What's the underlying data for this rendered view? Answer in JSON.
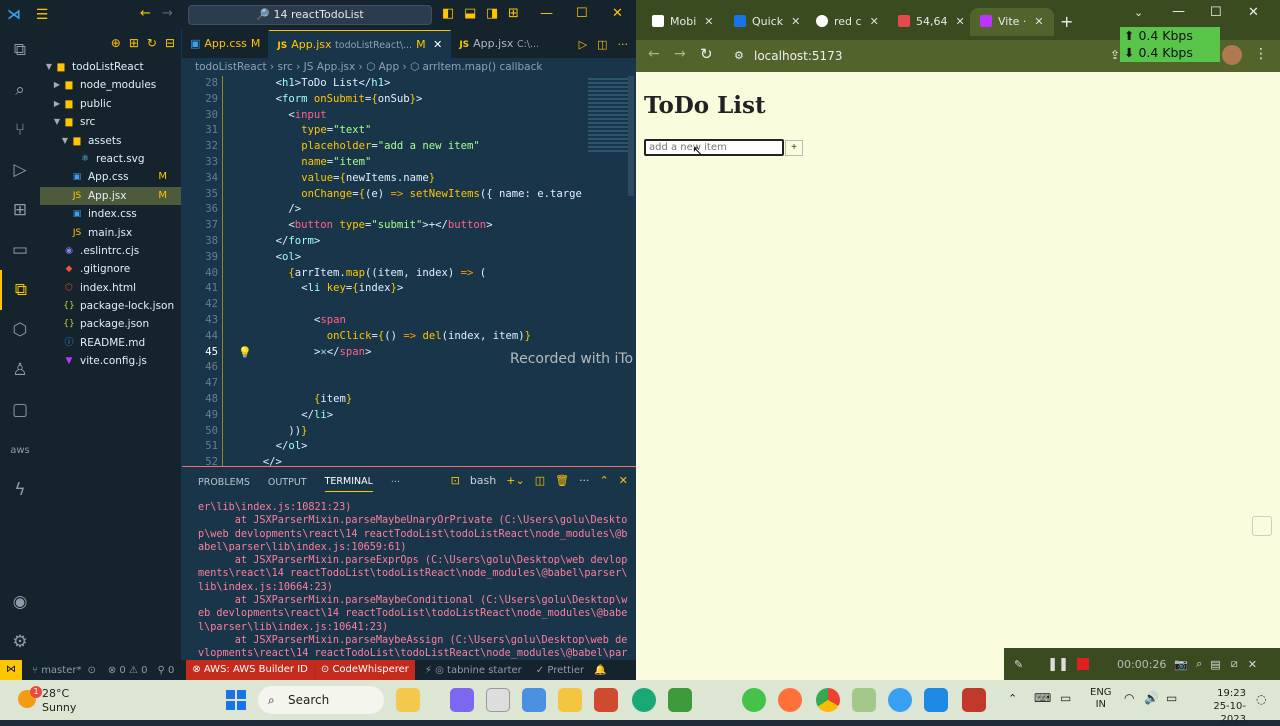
{
  "vscode": {
    "search_title": "🔎 14 reactTodoList",
    "explorer": {
      "root": "todoListReact",
      "items": [
        {
          "label": "node_modules",
          "kind": "folder",
          "depth": 1
        },
        {
          "label": "public",
          "kind": "folder",
          "depth": 1
        },
        {
          "label": "src",
          "kind": "folder-open",
          "depth": 1
        },
        {
          "label": "assets",
          "kind": "folder-open",
          "depth": 2
        },
        {
          "label": "react.svg",
          "kind": "svg",
          "depth": 3
        },
        {
          "label": "App.css",
          "kind": "css",
          "depth": 2,
          "badge": "M"
        },
        {
          "label": "App.jsx",
          "kind": "js",
          "depth": 2,
          "badge": "M"
        },
        {
          "label": "index.css",
          "kind": "css",
          "depth": 2
        },
        {
          "label": "main.jsx",
          "kind": "js",
          "depth": 2
        },
        {
          "label": ".eslintrc.cjs",
          "kind": "eslint",
          "depth": 1
        },
        {
          "label": ".gitignore",
          "kind": "git",
          "depth": 1
        },
        {
          "label": "index.html",
          "kind": "html",
          "depth": 1
        },
        {
          "label": "package-lock.json",
          "kind": "json",
          "depth": 1
        },
        {
          "label": "package.json",
          "kind": "json",
          "depth": 1
        },
        {
          "label": "README.md",
          "kind": "md",
          "depth": 1
        },
        {
          "label": "vite.config.js",
          "kind": "vite",
          "depth": 1
        }
      ]
    },
    "tabs": [
      {
        "label": "App.css",
        "badge": "M"
      },
      {
        "label": "App.jsx",
        "path": "todoListReact\\...",
        "badge": "M"
      },
      {
        "label": "App.jsx",
        "path": "C:\\..."
      }
    ],
    "breadcrumb": "todoListReact  ›  src  ›  JS App.jsx  ›  ⬡ App  ›  ⬡ arrItem.map() callback",
    "code_lines": [
      {
        "n": "28",
        "html": "&lt;<span class='c-tag'>h1</span>&gt;ToDo List&lt;/<span class='c-tag'>h1</span>&gt;",
        "indent": 4
      },
      {
        "n": "29",
        "html": "&lt;<span class='c-tag'>form</span> <span class='c-attr'>onSubmit</span>=<span class='c-br'>{</span>onSub<span class='c-br'>}</span>&gt;",
        "indent": 4
      },
      {
        "n": "30",
        "html": "&lt;<span class='c-pk'>input</span>",
        "indent": 6
      },
      {
        "n": "31",
        "html": "<span class='c-attr'>type</span>=<span class='c-str'>\"text\"</span>",
        "indent": 8
      },
      {
        "n": "32",
        "html": "<span class='c-attr'>placeholder</span>=<span class='c-str'>\"add a new item\"</span>",
        "indent": 8
      },
      {
        "n": "33",
        "html": "<span class='c-attr'>name</span>=<span class='c-str'>\"item\"</span>",
        "indent": 8
      },
      {
        "n": "34",
        "html": "<span class='c-attr'>value</span>=<span class='c-br'>{</span>newItems.name<span class='c-br'>}</span>",
        "indent": 8
      },
      {
        "n": "35",
        "html": "<span class='c-attr'>onChange</span>=<span class='c-br'>{</span>(e) <span class='c-op'>=&gt;</span> <span class='c-fn'>setNewItems</span>({ name: e.targe",
        "indent": 8
      },
      {
        "n": "36",
        "html": "/&gt;",
        "indent": 6
      },
      {
        "n": "37",
        "html": "&lt;<span class='c-pk'>button</span> <span class='c-attr'>type</span>=<span class='c-str'>\"submit\"</span>&gt;+&lt;/<span class='c-pk'>button</span>&gt;",
        "indent": 6
      },
      {
        "n": "38",
        "html": "&lt;/<span class='c-tag'>form</span>&gt;",
        "indent": 4
      },
      {
        "n": "39",
        "html": "&lt;<span class='c-tag'>ol</span>&gt;",
        "indent": 4
      },
      {
        "n": "40",
        "html": "<span class='c-br'>{</span>arrItem.<span class='c-fn'>map</span>((item, index) <span class='c-op'>=&gt;</span> (",
        "indent": 6
      },
      {
        "n": "41",
        "html": "&lt;<span class='c-tag'>li</span> <span class='c-attr'>key</span>=<span class='c-br'>{</span>index<span class='c-br'>}</span>&gt;",
        "indent": 8
      },
      {
        "n": "42",
        "html": "",
        "indent": 0
      },
      {
        "n": "43",
        "html": "&lt;<span class='c-pk'>span</span>",
        "indent": 10
      },
      {
        "n": "44",
        "html": "<span class='c-attr'>onClick</span>=<span class='c-br'>{</span>() <span class='c-op'>=&gt;</span> <span class='c-fn'>del</span>(index, item)<span class='c-br'>}</span>",
        "indent": 12
      },
      {
        "n": "45",
        "html": "&gt;<span style='color:#b0c4de'>✕</span>&lt;/<span class='c-pk'>span</span>&gt;",
        "indent": 10
      },
      {
        "n": "46",
        "html": "",
        "indent": 0
      },
      {
        "n": "47",
        "html": "",
        "indent": 0
      },
      {
        "n": "48",
        "html": "<span class='c-br'>{</span>item<span class='c-br'>}</span>",
        "indent": 10
      },
      {
        "n": "49",
        "html": "&lt;/<span class='c-tag'>li</span>&gt;",
        "indent": 8
      },
      {
        "n": "50",
        "html": "))<span class='c-br'>}</span>",
        "indent": 6
      },
      {
        "n": "51",
        "html": "&lt;/<span class='c-tag'>ol</span>&gt;",
        "indent": 4
      },
      {
        "n": "52",
        "html": "&lt;/&gt;",
        "indent": 2
      }
    ],
    "recorded_watermark": "Recorded with iTo",
    "panel": {
      "tabs": [
        "PROBLEMS",
        "OUTPUT",
        "TERMINAL",
        "···"
      ],
      "active_tab": "TERMINAL",
      "shell": "bash",
      "terminal_text": "er\\lib\\index.js:10821:23)\n      at JSXParserMixin.parseMaybeUnaryOrPrivate (C:\\Users\\golu\\Deskto\np\\web devlopments\\react\\14 reactTodoList\\todoListReact\\node_modules\\@b\nabel\\parser\\lib\\index.js:10659:61)\n      at JSXParserMixin.parseExprOps (C:\\Users\\golu\\Desktop\\web devlop\nments\\react\\14 reactTodoList\\todoListReact\\node_modules\\@babel\\parser\\\nlib\\index.js:10664:23)\n      at JSXParserMixin.parseMaybeConditional (C:\\Users\\golu\\Desktop\\w\neb devlopments\\react\\14 reactTodoList\\todoListReact\\node_modules\\@babe\nl\\parser\\lib\\index.js:10641:23)\n      at JSXParserMixin.parseMaybeAssign (C:\\Users\\golu\\Desktop\\web de\nvlopments\\react\\14 reactTodoList\\todoListReact\\node_modules\\@babel\\par"
    },
    "status": {
      "branch": "master*",
      "problems": "⊗ 0 ⚠ 0",
      "ports": "⚲ 0",
      "aws": "AWS: AWS Builder ID",
      "codewhisperer": "CodeWhisperer",
      "tabnine": "tabnine starter",
      "prettier": "Prettier"
    }
  },
  "chrome": {
    "tabs": [
      {
        "label": "Mobi",
        "color": "#ffffff"
      },
      {
        "label": "Quick",
        "color": "#1a73e8"
      },
      {
        "label": "red c",
        "color": "#ffffff"
      },
      {
        "label": "54,64",
        "color": "#e5484d"
      },
      {
        "label": "Vite ·",
        "color": "#bd34fe",
        "active": true
      }
    ],
    "url": "localhost:5173",
    "speed_up": "0.4 Kbps",
    "speed_down": "0.4 Kbps",
    "page": {
      "heading": "ToDo List",
      "input_placeholder": "add a new item",
      "add_button": "+"
    }
  },
  "recorder": {
    "time": "00:00:26"
  },
  "taskbar": {
    "weather_temp": "28°C",
    "weather_desc": "Sunny",
    "weather_badge": "1",
    "search": "Search",
    "lang": "ENG",
    "region": "IN",
    "time": "19:23",
    "date": "25-10-2023"
  }
}
